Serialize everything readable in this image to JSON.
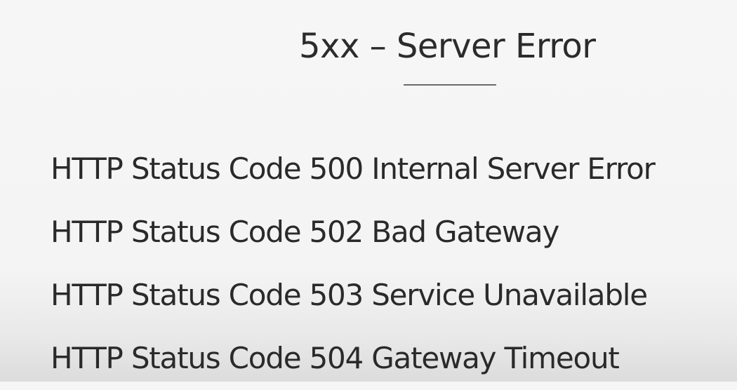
{
  "slide": {
    "title": "5xx – Server Error",
    "items": [
      "HTTP Status Code 500 Internal Server Error",
      "HTTP Status Code 502 Bad Gateway",
      "HTTP Status Code 503 Service Unavailable",
      "HTTP Status Code 504 Gateway Timeout"
    ]
  }
}
